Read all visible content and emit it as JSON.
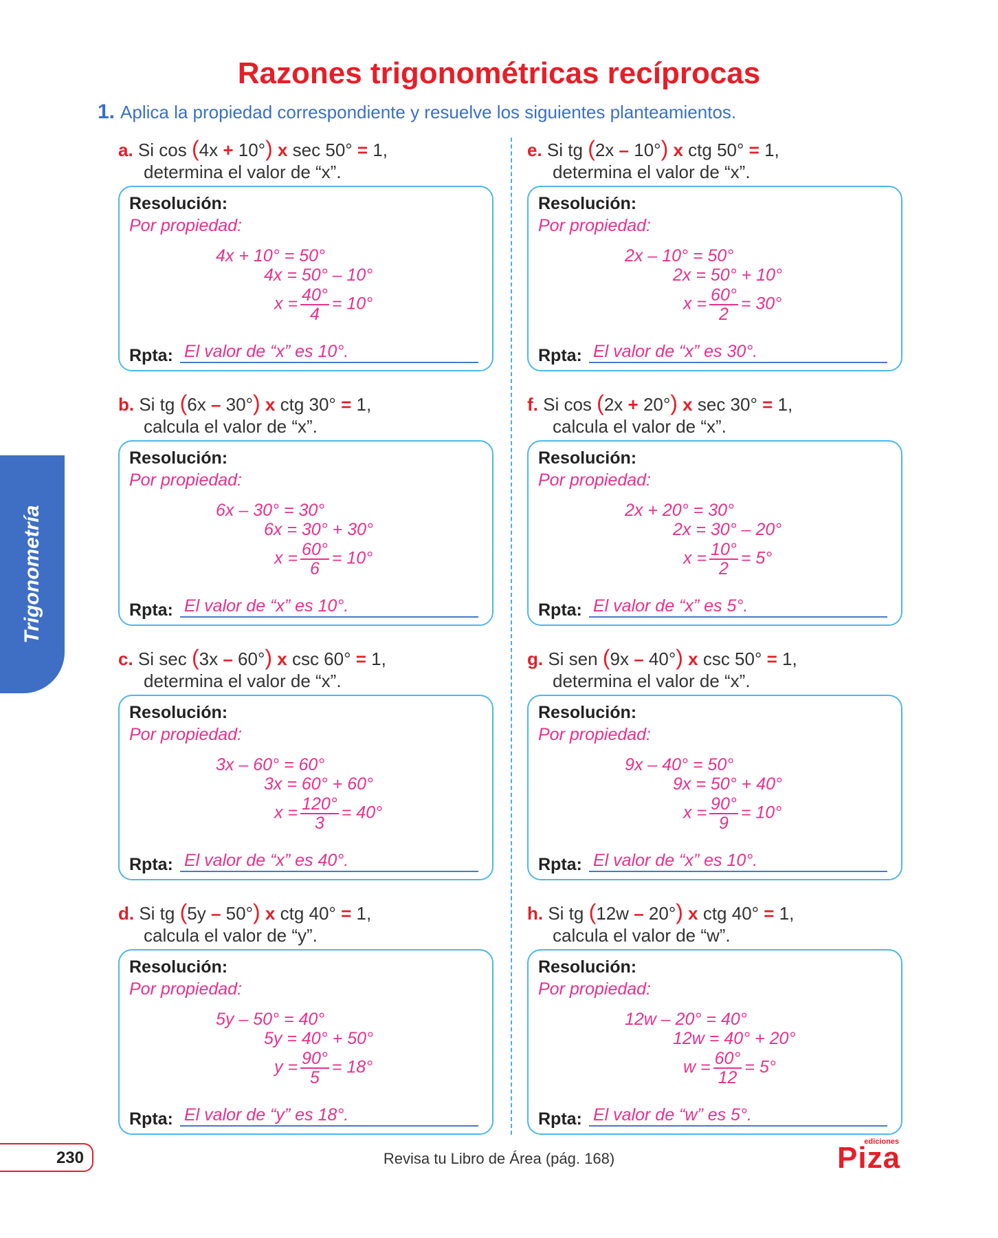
{
  "title": "Razones trigonométricas recíprocas",
  "instruction": {
    "number": "1.",
    "text": "Aplica la propiedad correspondiente y resuelve los siguientes planteamientos."
  },
  "side_tab": "Trigonometría",
  "labels": {
    "resolution": "Resolución:",
    "property": "Por propiedad:",
    "answer": "Rpta:"
  },
  "problems": [
    {
      "letter": "a.",
      "fn1": "Si cos",
      "arg_a": "4x",
      "arg_op": "+",
      "arg_b": "10°",
      "mult": "x",
      "fn2": "sec 50°",
      "eq": "=",
      "rhs": "1,",
      "line2": "determina el valor de “x”.",
      "eq1": "4x + 10° = 50°",
      "eq2": "4x = 50° – 10°",
      "eq3_lhs": "x =",
      "num": "40°",
      "den": "4",
      "eq3_rhs": "= 10°",
      "answer": "El valor de “x” es 10°."
    },
    {
      "letter": "b.",
      "fn1": "Si tg",
      "arg_a": "6x",
      "arg_op": "–",
      "arg_b": "30°",
      "mult": "x",
      "fn2": "ctg 30°",
      "eq": "=",
      "rhs": "1,",
      "line2": "calcula el valor de “x”.",
      "eq1": "6x – 30° = 30°",
      "eq2": "6x = 30° + 30°",
      "eq3_lhs": "x =",
      "num": "60°",
      "den": "6",
      "eq3_rhs": "= 10°",
      "answer": "El valor de “x” es 10°."
    },
    {
      "letter": "c.",
      "fn1": "Si sec",
      "arg_a": "3x",
      "arg_op": "–",
      "arg_b": "60°",
      "mult": "x",
      "fn2": "csc 60°",
      "eq": "=",
      "rhs": "1,",
      "line2": "determina el valor de “x”.",
      "eq1": "3x – 60° = 60°",
      "eq2": "3x = 60° + 60°",
      "eq3_lhs": "x =",
      "num": "120°",
      "den": "3",
      "eq3_rhs": "= 40°",
      "answer": "El valor de “x” es 40°."
    },
    {
      "letter": "d.",
      "fn1": "Si tg",
      "arg_a": "5y",
      "arg_op": "–",
      "arg_b": "50°",
      "mult": "x",
      "fn2": "ctg 40°",
      "eq": "=",
      "rhs": "1,",
      "line2": "calcula el valor de “y”.",
      "eq1": "5y – 50° = 40°",
      "eq2": "5y = 40° + 50°",
      "eq3_lhs": "y =",
      "num": "90°",
      "den": "5",
      "eq3_rhs": "= 18°",
      "answer": "El valor de “y” es 18°."
    },
    {
      "letter": "e.",
      "fn1": "Si tg",
      "arg_a": "2x",
      "arg_op": "–",
      "arg_b": "10°",
      "mult": "x",
      "fn2": "ctg 50°",
      "eq": "=",
      "rhs": "1,",
      "line2": "determina el valor de “x”.",
      "eq1": "2x – 10° = 50°",
      "eq2": "2x = 50° + 10°",
      "eq3_lhs": "x =",
      "num": "60°",
      "den": "2",
      "eq3_rhs": "= 30°",
      "answer": "El valor de “x” es 30°."
    },
    {
      "letter": "f.",
      "fn1": "Si cos",
      "arg_a": "2x",
      "arg_op": "+",
      "arg_b": "20°",
      "mult": "x",
      "fn2": "sec 30°",
      "eq": "=",
      "rhs": "1,",
      "line2": "calcula el valor de “x”.",
      "eq1": "2x + 20° = 30°",
      "eq2": "2x = 30° – 20°",
      "eq3_lhs": "x =",
      "num": "10°",
      "den": "2",
      "eq3_rhs": "= 5°",
      "answer": "El valor de “x” es 5°."
    },
    {
      "letter": "g.",
      "fn1": "Si sen",
      "arg_a": "9x",
      "arg_op": "–",
      "arg_b": "40°",
      "mult": "x",
      "fn2": "csc 50°",
      "eq": "=",
      "rhs": "1,",
      "line2": "determina el valor de “x”.",
      "eq1": "9x – 40° = 50°",
      "eq2": "9x = 50° + 40°",
      "eq3_lhs": "x =",
      "num": "90°",
      "den": "9",
      "eq3_rhs": "= 10°",
      "answer": "El valor de “x” es 10°."
    },
    {
      "letter": "h.",
      "fn1": "Si tg",
      "arg_a": "12w",
      "arg_op": "–",
      "arg_b": "20°",
      "mult": "x",
      "fn2": "ctg 40°",
      "eq": "=",
      "rhs": "1,",
      "line2": "calcula el valor de “w”.",
      "eq1": "12w – 20° = 40°",
      "eq2": "12w = 40° + 20°",
      "eq3_lhs": "w =",
      "num": "60°",
      "den": "12",
      "eq3_rhs": "= 5°",
      "answer": "El valor de “w” es 5°."
    }
  ],
  "footer": {
    "page": "230",
    "text": "Revisa tu Libro de Área (pág. 168)",
    "logo_small": "ediciones",
    "logo": "Piza"
  },
  "colors": {
    "title": "#e61e28",
    "instruction": "#3a6fc9",
    "handwriting": "#e8308c",
    "box_border": "#4cb8e8",
    "tab": "#3e6fc4"
  }
}
